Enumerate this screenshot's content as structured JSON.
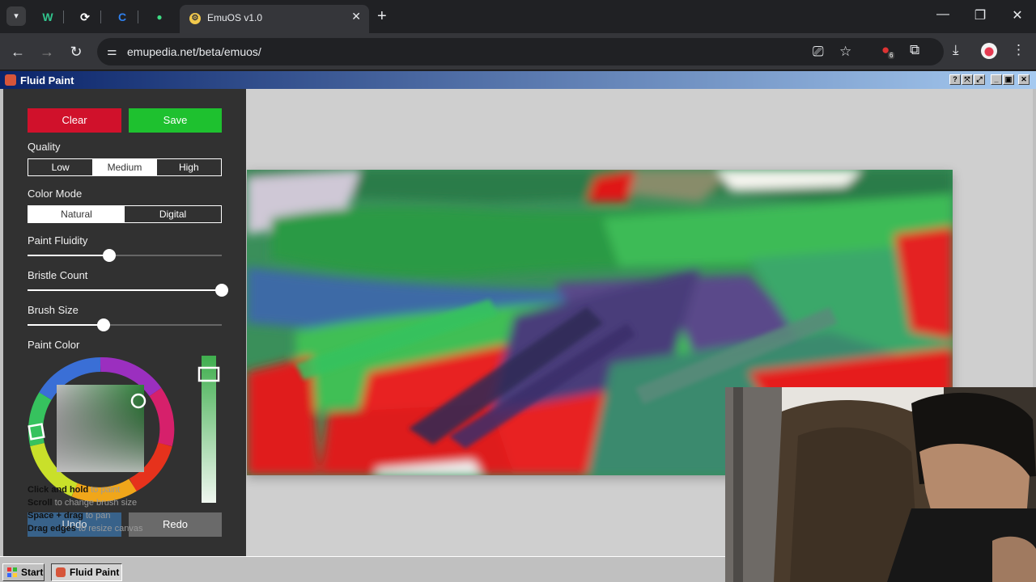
{
  "browser": {
    "tab_menu_icon": "chevron-down-icon",
    "pinned_tabs": [
      {
        "glyph": "W",
        "color": "#31c48d"
      },
      {
        "glyph": "⟳",
        "color": "#ffffff"
      },
      {
        "glyph": "C",
        "color": "#2f80ed"
      },
      {
        "glyph": "●",
        "color": "#3ddc84"
      }
    ],
    "active_tab": {
      "title": "EmuOS v1.0",
      "close": "✕"
    },
    "new_tab": "+",
    "window_controls": {
      "minimize": "—",
      "restore": "❐",
      "close": "✕"
    },
    "nav": {
      "back": "←",
      "forward": "→",
      "reload": "↻"
    },
    "url": "emupedia.net/beta/emuos/",
    "extension_badge": "6"
  },
  "emuos": {
    "window_title": "Fluid Paint",
    "title_buttons": [
      "?",
      "⤧",
      "⤢",
      "_",
      "▣",
      "✕"
    ],
    "taskbar": {
      "start": "Start",
      "task": "Fluid Paint"
    }
  },
  "fluid_paint": {
    "clear_label": "Clear",
    "save_label": "Save",
    "quality": {
      "label": "Quality",
      "options": [
        "Low",
        "Medium",
        "High"
      ],
      "selected": "Medium"
    },
    "color_mode": {
      "label": "Color Mode",
      "options": [
        "Natural",
        "Digital"
      ],
      "selected": "Natural"
    },
    "paint_fluidity": {
      "label": "Paint Fluidity",
      "value": 0.42
    },
    "bristle_count": {
      "label": "Bristle Count",
      "value": 1.0
    },
    "brush_size": {
      "label": "Brush Size",
      "value": 0.39
    },
    "paint_color": {
      "label": "Paint Color",
      "color": "#3fae4e"
    },
    "undo_label": "Undo",
    "redo_label": "Redo",
    "hints": [
      {
        "key": "Click and hold",
        "text": " to paint"
      },
      {
        "key": "Scroll",
        "text": " to change brush size"
      },
      {
        "key": "Space + drag",
        "text": " to pan"
      },
      {
        "key": "Drag edges",
        "text": " to resize canvas"
      }
    ]
  },
  "colors": {
    "clear": "#d0112b",
    "save": "#1ec12f",
    "titlebar": "#0a246a"
  }
}
